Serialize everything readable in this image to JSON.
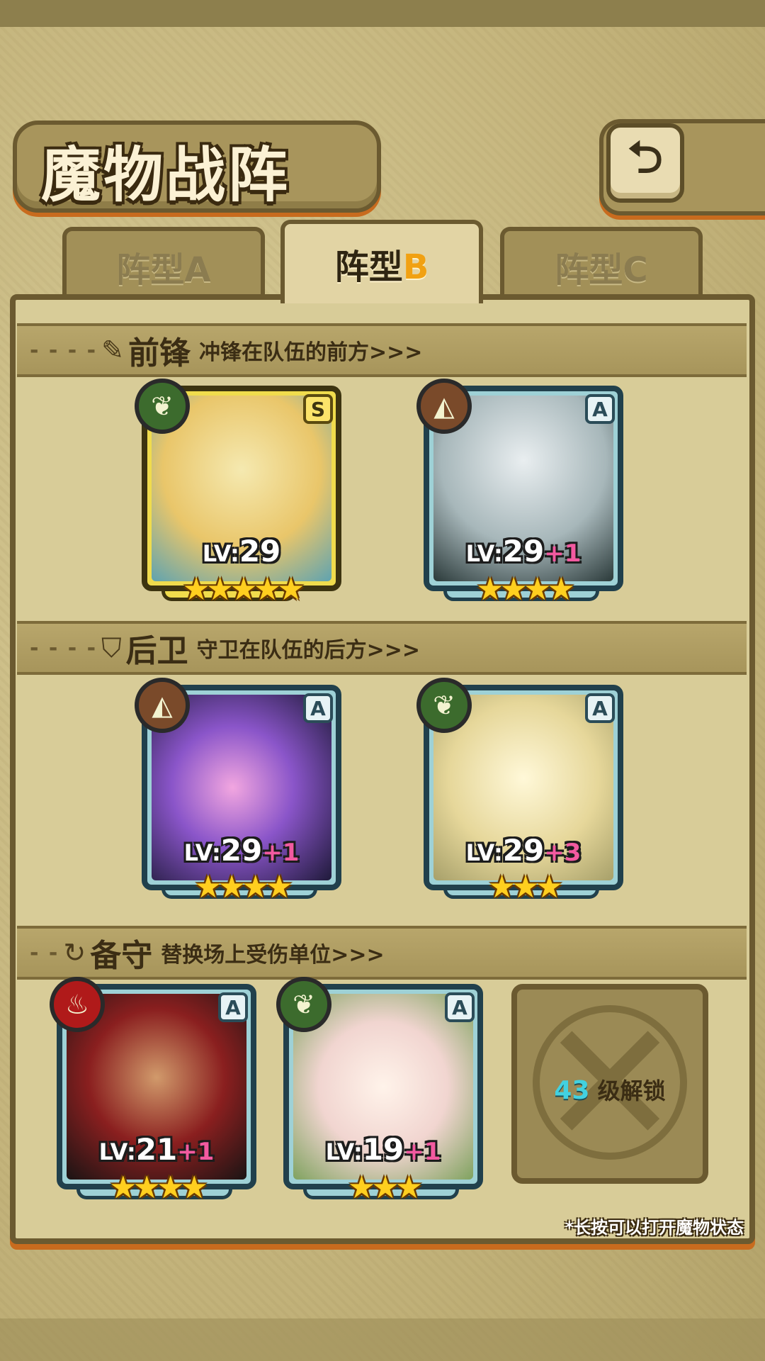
{
  "header": {
    "title": "魔物战阵",
    "back_icon": "back-arrow-icon"
  },
  "tabs": [
    {
      "prefix": "阵型",
      "suffix": "A",
      "active": false
    },
    {
      "prefix": "阵型",
      "suffix": "B",
      "active": true
    },
    {
      "prefix": "阵型",
      "suffix": "C",
      "active": false
    }
  ],
  "sections": {
    "vanguard": {
      "icon": "sword-icon",
      "title": "前锋",
      "desc": "冲锋在队伍的前方>>>"
    },
    "rear": {
      "icon": "shield-icon",
      "title": "后卫",
      "desc": "守卫在队伍的后方>>>"
    },
    "reserve": {
      "icon": "swap-icon",
      "title": "备守",
      "desc": "替换场上受伤单位>>>"
    }
  },
  "cards": [
    {
      "rank": "S",
      "element": "leaf-icon",
      "lv_label": "LV:",
      "level": "29",
      "plus": "",
      "stars": "★★★★★"
    },
    {
      "rank": "A",
      "element": "earth-icon",
      "lv_label": "LV:",
      "level": "29",
      "plus": "+1",
      "stars": "★★★★"
    },
    {
      "rank": "A",
      "element": "earth-icon",
      "lv_label": "LV:",
      "level": "29",
      "plus": "+1",
      "stars": "★★★★"
    },
    {
      "rank": "A",
      "element": "leaf-icon",
      "lv_label": "LV:",
      "level": "29",
      "plus": "+3",
      "stars": "★★★"
    },
    {
      "rank": "A",
      "element": "fire-icon",
      "lv_label": "LV:",
      "level": "21",
      "plus": "+1",
      "stars": "★★★★"
    },
    {
      "rank": "A",
      "element": "leaf-icon",
      "lv_label": "LV:",
      "level": "19",
      "plus": "+1",
      "stars": "★★★"
    }
  ],
  "locked_slot": {
    "level": "43",
    "text": "级解锁"
  },
  "hint": "*长按可以打开魔物状态",
  "colors": {
    "accent_orange": "#f1a112",
    "plus_pink": "#f25aa0",
    "unlock_cyan": "#42d1e0"
  }
}
